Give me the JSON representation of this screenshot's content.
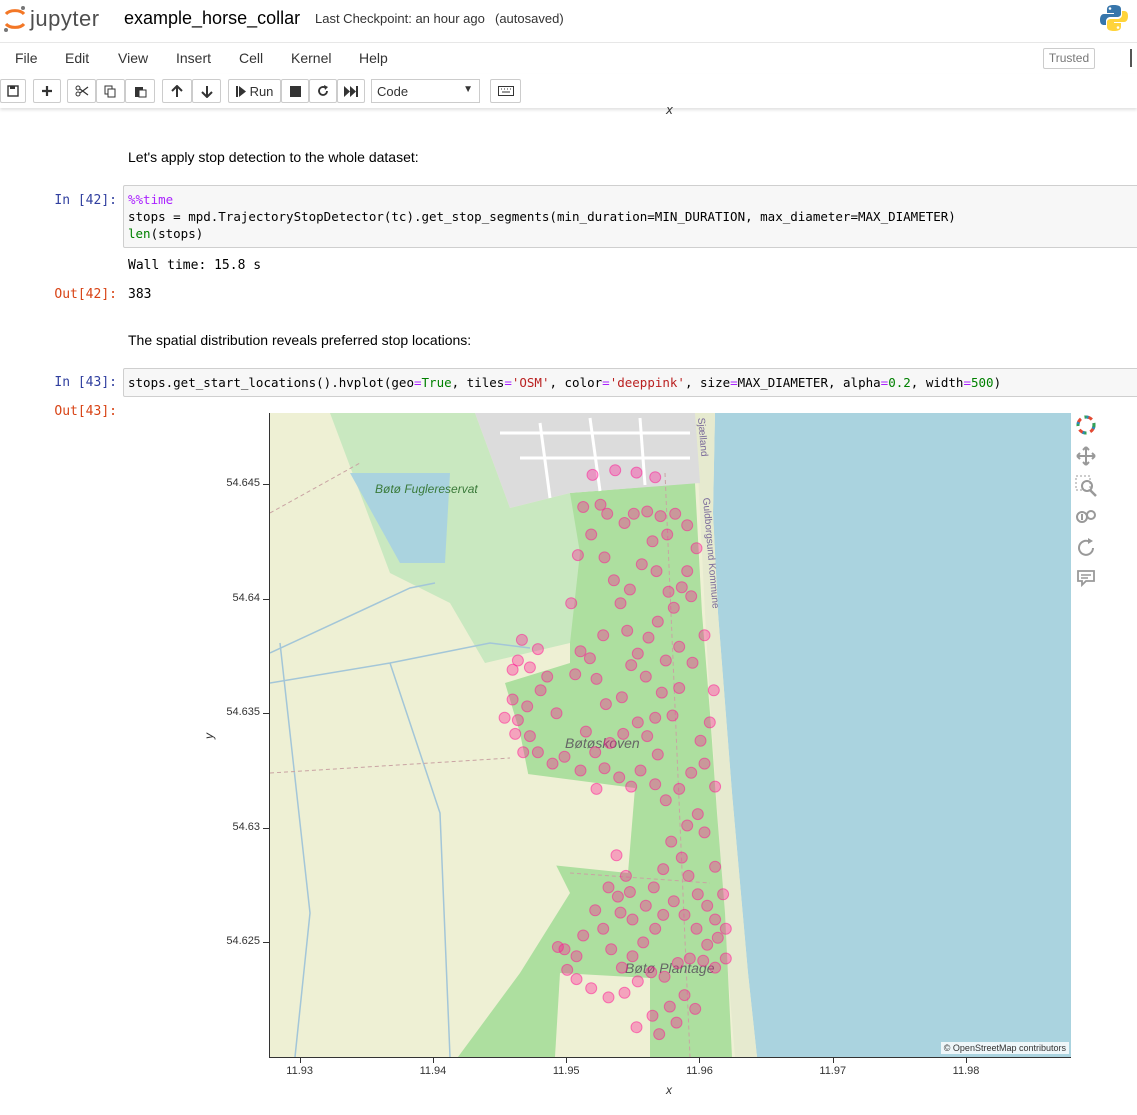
{
  "header": {
    "logo_text": "jupyter",
    "notebook_name": "example_horse_collar",
    "checkpoint": "Last Checkpoint: an hour ago",
    "autosave": "(autosaved)"
  },
  "menubar": {
    "items": [
      "File",
      "Edit",
      "View",
      "Insert",
      "Cell",
      "Kernel",
      "Help"
    ],
    "trusted": "Trusted"
  },
  "toolbar": {
    "run_label": "Run",
    "cell_type": "Code"
  },
  "cells": {
    "top_x_label": "x",
    "md1": "Let's apply stop detection to the whole dataset:",
    "in42_prompt": "In [42]:",
    "in42_line1_magic": "%%time",
    "in42_line2": "stops = mpd.TrajectoryStopDetector(tc).get_stop_segments(min_duration=MIN_DURATION, max_diameter=MAX_DIAMETER)",
    "in42_line3_fn": "len",
    "in42_line3_rest": "(stops)",
    "stdout42": "Wall time: 15.8 s",
    "out42_prompt": "Out[42]:",
    "out42_value": "383",
    "md2": "The spatial distribution reveals preferred stop locations:",
    "in43_prompt": "In [43]:",
    "out43_prompt": "Out[43]:"
  },
  "chart_data": {
    "type": "scatter",
    "title": "",
    "xlabel": "x",
    "ylabel": "y",
    "x_ticks": [
      "11.93",
      "11.94",
      "11.95",
      "11.96",
      "11.97",
      "11.98"
    ],
    "y_ticks": [
      "54.645",
      "54.64",
      "54.635",
      "54.63",
      "54.625"
    ],
    "xlim": [
      11.9277,
      11.9878
    ],
    "ylim": [
      54.62,
      54.6481
    ],
    "point_color": "#ff1493",
    "alpha": 0.2,
    "map_labels": [
      "Bøtø Fuglereservat",
      "Bøtøskoven",
      "Bøtø Plantage",
      "Guldborgsund Kommune",
      "Sjælland"
    ],
    "attribution": "© OpenStreetMap contributors",
    "points": [
      [
        11.9519,
        54.6454
      ],
      [
        11.9536,
        54.6456
      ],
      [
        11.9552,
        54.6455
      ],
      [
        11.9566,
        54.6453
      ],
      [
        11.9525,
        54.6441
      ],
      [
        11.953,
        54.6437
      ],
      [
        11.9543,
        54.6433
      ],
      [
        11.955,
        54.6437
      ],
      [
        11.956,
        54.6438
      ],
      [
        11.957,
        54.6436
      ],
      [
        11.9581,
        54.6437
      ],
      [
        11.959,
        54.6432
      ],
      [
        11.9575,
        54.6428
      ],
      [
        11.9564,
        54.6425
      ],
      [
        11.9597,
        54.6422
      ],
      [
        11.959,
        54.6412
      ],
      [
        11.9586,
        54.6405
      ],
      [
        11.9593,
        54.6401
      ],
      [
        11.958,
        54.6396
      ],
      [
        11.9576,
        54.6403
      ],
      [
        11.9568,
        54.639
      ],
      [
        11.9561,
        54.6383
      ],
      [
        11.9553,
        54.6376
      ],
      [
        11.9545,
        54.6386
      ],
      [
        11.954,
        54.6398
      ],
      [
        11.9535,
        54.6408
      ],
      [
        11.9528,
        54.6418
      ],
      [
        11.9518,
        54.6428
      ],
      [
        11.9512,
        54.644
      ],
      [
        11.9508,
        54.6419
      ],
      [
        11.9503,
        54.6398
      ],
      [
        11.951,
        54.6377
      ],
      [
        11.9522,
        54.6365
      ],
      [
        11.9529,
        54.6354
      ],
      [
        11.9541,
        54.6357
      ],
      [
        11.9548,
        54.6371
      ],
      [
        11.9559,
        54.6366
      ],
      [
        11.9571,
        54.6359
      ],
      [
        11.9579,
        54.6349
      ],
      [
        11.9584,
        54.6361
      ],
      [
        11.9594,
        54.6372
      ],
      [
        11.9603,
        54.6384
      ],
      [
        11.961,
        54.636
      ],
      [
        11.9607,
        54.6346
      ],
      [
        11.96,
        54.6338
      ],
      [
        11.9553,
        54.6346
      ],
      [
        11.956,
        54.634
      ],
      [
        11.9566,
        54.6348
      ],
      [
        11.9542,
        54.6341
      ],
      [
        11.9532,
        54.6337
      ],
      [
        11.9521,
        54.6333
      ],
      [
        11.9514,
        54.6342
      ],
      [
        11.951,
        54.6325
      ],
      [
        11.9522,
        54.6317
      ],
      [
        11.9528,
        54.6326
      ],
      [
        11.9539,
        54.6322
      ],
      [
        11.9548,
        54.6318
      ],
      [
        11.9555,
        54.6325
      ],
      [
        11.9566,
        54.6319
      ],
      [
        11.9574,
        54.6312
      ],
      [
        11.9584,
        54.6317
      ],
      [
        11.9593,
        54.6324
      ],
      [
        11.9603,
        54.6328
      ],
      [
        11.9611,
        54.6318
      ],
      [
        11.9598,
        54.6306
      ],
      [
        11.959,
        54.6301
      ],
      [
        11.9568,
        54.6332
      ],
      [
        11.9459,
        54.6369
      ],
      [
        11.9463,
        54.6373
      ],
      [
        11.9472,
        54.637
      ],
      [
        11.9478,
        54.6378
      ],
      [
        11.9466,
        54.6382
      ],
      [
        11.9485,
        54.6366
      ],
      [
        11.948,
        54.636
      ],
      [
        11.947,
        54.6353
      ],
      [
        11.9459,
        54.6356
      ],
      [
        11.9453,
        54.6348
      ],
      [
        11.9463,
        54.6347
      ],
      [
        11.9461,
        54.6341
      ],
      [
        11.9472,
        54.634
      ],
      [
        11.9467,
        54.6333
      ],
      [
        11.9478,
        54.6333
      ],
      [
        11.9489,
        54.6328
      ],
      [
        11.9498,
        54.6331
      ],
      [
        11.9492,
        54.635
      ],
      [
        11.9537,
        54.6288
      ],
      [
        11.9544,
        54.6279
      ],
      [
        11.9547,
        54.6272
      ],
      [
        11.9538,
        54.627
      ],
      [
        11.9531,
        54.6274
      ],
      [
        11.954,
        54.6263
      ],
      [
        11.9549,
        54.626
      ],
      [
        11.9559,
        54.6266
      ],
      [
        11.9565,
        54.6274
      ],
      [
        11.9572,
        54.6282
      ],
      [
        11.9578,
        54.6294
      ],
      [
        11.9586,
        54.6287
      ],
      [
        11.9591,
        54.6279
      ],
      [
        11.9598,
        54.6271
      ],
      [
        11.9605,
        54.6266
      ],
      [
        11.9611,
        54.626
      ],
      [
        11.9619,
        54.6256
      ],
      [
        11.9613,
        54.6252
      ],
      [
        11.9605,
        54.6249
      ],
      [
        11.9597,
        54.6256
      ],
      [
        11.9588,
        54.6262
      ],
      [
        11.958,
        54.6268
      ],
      [
        11.9572,
        54.6262
      ],
      [
        11.9566,
        54.6256
      ],
      [
        11.9557,
        54.625
      ],
      [
        11.9549,
        54.6244
      ],
      [
        11.9541,
        54.6239
      ],
      [
        11.9533,
        54.6247
      ],
      [
        11.9527,
        54.6256
      ],
      [
        11.9521,
        54.6264
      ],
      [
        11.9512,
        54.6253
      ],
      [
        11.9507,
        54.6244
      ],
      [
        11.9498,
        54.6247
      ],
      [
        11.9493,
        54.6248
      ],
      [
        11.95,
        54.6238
      ],
      [
        11.9507,
        54.6234
      ],
      [
        11.9518,
        54.623
      ],
      [
        11.9531,
        54.6226
      ],
      [
        11.9543,
        54.6228
      ],
      [
        11.9553,
        54.6233
      ],
      [
        11.9563,
        54.6237
      ],
      [
        11.9573,
        54.6235
      ],
      [
        11.9583,
        54.6241
      ],
      [
        11.9592,
        54.6243
      ],
      [
        11.9602,
        54.6242
      ],
      [
        11.9611,
        54.6239
      ],
      [
        11.9619,
        54.6243
      ],
      [
        11.9617,
        54.6271
      ],
      [
        11.9611,
        54.6283
      ],
      [
        11.9603,
        54.6298
      ],
      [
        11.9552,
        54.6213
      ],
      [
        11.9564,
        54.6218
      ],
      [
        11.9577,
        54.6222
      ],
      [
        11.9588,
        54.6227
      ],
      [
        11.9596,
        54.6221
      ],
      [
        11.9582,
        54.6215
      ],
      [
        11.9569,
        54.621
      ],
      [
        11.9547,
        54.6404
      ],
      [
        11.9556,
        54.6415
      ],
      [
        11.9567,
        54.6412
      ],
      [
        11.9584,
        54.6379
      ],
      [
        11.9574,
        54.6373
      ],
      [
        11.9527,
        54.6384
      ],
      [
        11.9517,
        54.6374
      ],
      [
        11.9506,
        54.6367
      ]
    ]
  }
}
